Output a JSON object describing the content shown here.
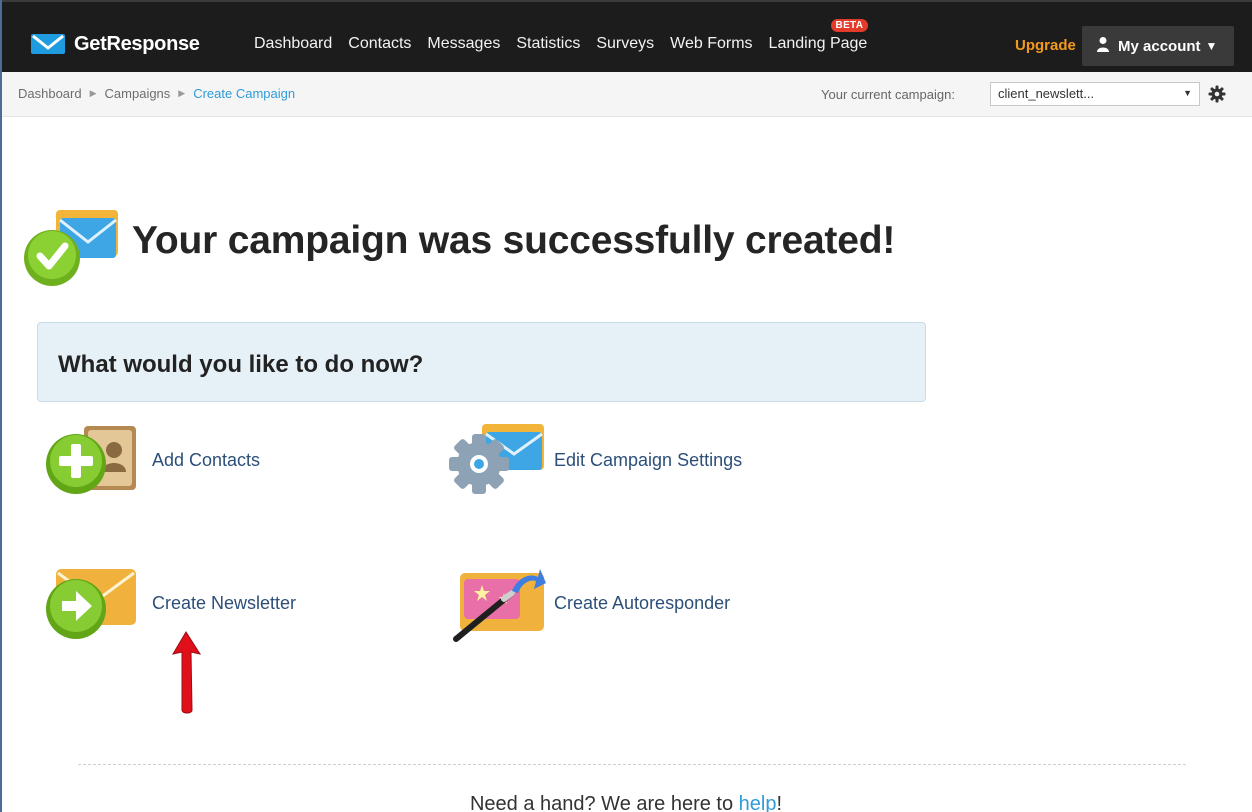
{
  "header": {
    "logo_text": "GetResponse",
    "nav": [
      "Dashboard",
      "Contacts",
      "Messages",
      "Statistics",
      "Surveys",
      "Web Forms",
      "Landing Page"
    ],
    "beta_badge": "BETA",
    "upgrade_label": "Upgrade",
    "account_label": "My account"
  },
  "breadcrumb": {
    "items": [
      "Dashboard",
      "Campaigns",
      "Create Campaign"
    ]
  },
  "campaign_selector": {
    "label": "Your current campaign:",
    "value": "client_newslett..."
  },
  "main": {
    "headline": "Your campaign was successfully created!",
    "question": "What would you like to do now?",
    "actions": {
      "add_contacts": "Add Contacts",
      "edit_settings": "Edit Campaign Settings",
      "create_newsletter": "Create Newsletter",
      "create_autoresponder": "Create Autoresponder"
    }
  },
  "footer": {
    "help_prefix": "Need a hand? We are here to ",
    "help_link": "help",
    "help_suffix": "!"
  },
  "colors": {
    "nav_bg": "#1c1c1c",
    "upgrade": "#f39a1d",
    "link": "#2f9cd8",
    "action_label": "#2c4f79",
    "panel_bg": "#e6f0f7",
    "success_green": "#7cc12a",
    "arrow_red": "#e0101b"
  },
  "icons": [
    "envelope-logo-icon",
    "user-icon",
    "gear-icon",
    "success-check-icon",
    "add-contacts-icon",
    "settings-gear-icon",
    "newsletter-icon",
    "autoresponder-wand-icon"
  ]
}
